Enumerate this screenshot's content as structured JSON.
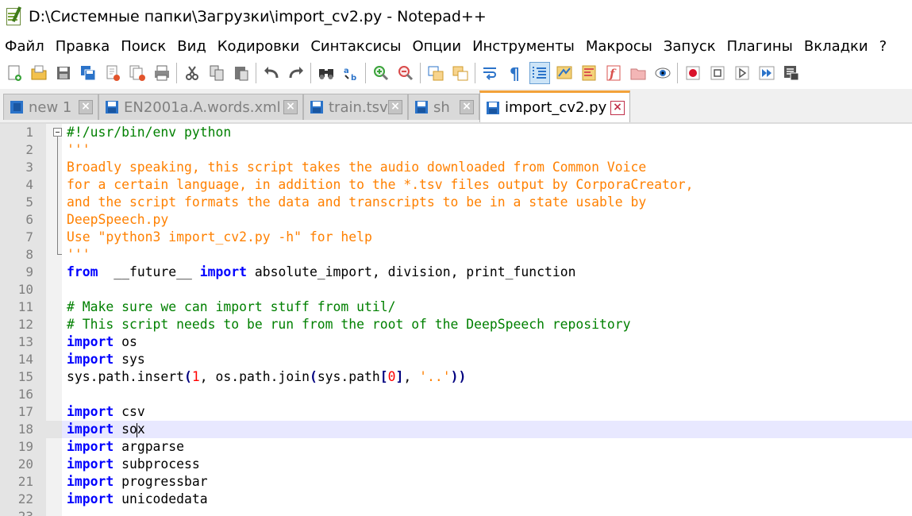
{
  "window": {
    "title": "D:\\Системные папки\\Загрузки\\import_cv2.py - Notepad++"
  },
  "menu": [
    "Файл",
    "Правка",
    "Поиск",
    "Вид",
    "Кодировки",
    "Синтаксисы",
    "Опции",
    "Инструменты",
    "Макросы",
    "Запуск",
    "Плагины",
    "Вкладки",
    "?"
  ],
  "toolbar": [
    {
      "name": "new-file-icon"
    },
    {
      "name": "open-file-icon"
    },
    {
      "name": "save-icon"
    },
    {
      "name": "save-all-icon"
    },
    {
      "name": "close-icon"
    },
    {
      "name": "close-all-icon"
    },
    {
      "name": "print-icon"
    },
    {
      "sep": true
    },
    {
      "name": "cut-icon"
    },
    {
      "name": "copy-icon"
    },
    {
      "name": "paste-icon"
    },
    {
      "sep": true
    },
    {
      "name": "undo-icon"
    },
    {
      "name": "redo-icon"
    },
    {
      "sep": true
    },
    {
      "name": "find-icon"
    },
    {
      "name": "replace-icon"
    },
    {
      "sep": true
    },
    {
      "name": "zoom-in-icon"
    },
    {
      "name": "zoom-out-icon"
    },
    {
      "sep": true
    },
    {
      "name": "sync-vertical-icon"
    },
    {
      "name": "sync-horizontal-icon"
    },
    {
      "sep": true
    },
    {
      "name": "word-wrap-icon"
    },
    {
      "name": "show-all-characters-icon"
    },
    {
      "name": "indent-guide-icon",
      "pressed": true
    },
    {
      "name": "user-language-icon"
    },
    {
      "name": "document-map-icon"
    },
    {
      "name": "function-list-icon"
    },
    {
      "name": "folder-workspace-icon"
    },
    {
      "name": "monitoring-icon"
    },
    {
      "sep": true
    },
    {
      "name": "record-macro-icon"
    },
    {
      "name": "stop-recording-icon"
    },
    {
      "name": "playback-macro-icon"
    },
    {
      "name": "run-macro-multiple-icon"
    },
    {
      "name": "save-macro-icon"
    }
  ],
  "tabs": [
    {
      "label": "new 1",
      "icon": "notebook"
    },
    {
      "label": "EN2001a.A.words.xml",
      "icon": "disk"
    },
    {
      "label": "train.tsv",
      "icon": "disk"
    },
    {
      "label": "sh",
      "icon": "disk"
    },
    {
      "label": "import_cv2.py",
      "icon": "disk",
      "active": true
    }
  ],
  "editor": {
    "current_line": 18,
    "lines": [
      [
        [
          "com",
          "#!/usr/bin/env python"
        ]
      ],
      [
        [
          "str",
          "'''"
        ]
      ],
      [
        [
          "str",
          "Broadly speaking, this script takes the audio downloaded from Common Voice"
        ]
      ],
      [
        [
          "str",
          "for a certain language, in addition to the *.tsv files output by CorporaCreator,"
        ]
      ],
      [
        [
          "str",
          "and the script formats the data and transcripts to be in a state usable by"
        ]
      ],
      [
        [
          "str",
          "DeepSpeech.py"
        ]
      ],
      [
        [
          "str",
          "Use \"python3 import_cv2.py -h\" for help"
        ]
      ],
      [
        [
          "str",
          "'''"
        ]
      ],
      [
        [
          "kw",
          "from"
        ],
        [
          "",
          "  __future__ "
        ],
        [
          "kw",
          "import"
        ],
        [
          "",
          " absolute_import, division, print_function"
        ]
      ],
      [],
      [
        [
          "com",
          "# Make sure we can import stuff from util/"
        ]
      ],
      [
        [
          "com",
          "# This script needs to be run from the root of the DeepSpeech repository"
        ]
      ],
      [
        [
          "kw",
          "import"
        ],
        [
          "",
          " os"
        ]
      ],
      [
        [
          "kw",
          "import"
        ],
        [
          "",
          " sys"
        ]
      ],
      [
        [
          "",
          "sys.path.insert"
        ],
        [
          "op",
          "("
        ],
        [
          "num",
          "1"
        ],
        [
          "",
          ", os.path.join"
        ],
        [
          "op",
          "("
        ],
        [
          "",
          "sys.path"
        ],
        [
          "op",
          "["
        ],
        [
          "num",
          "0"
        ],
        [
          "op",
          "]"
        ],
        [
          "",
          ", "
        ],
        [
          "str",
          "'..'"
        ],
        [
          "op",
          "))"
        ]
      ],
      [],
      [
        [
          "kw",
          "import"
        ],
        [
          "",
          " csv"
        ]
      ],
      [
        [
          "kw",
          "import"
        ],
        [
          "",
          " so"
        ],
        [
          "caret",
          ""
        ],
        [
          "",
          "x"
        ]
      ],
      [
        [
          "kw",
          "import"
        ],
        [
          "",
          " argparse"
        ]
      ],
      [
        [
          "kw",
          "import"
        ],
        [
          "",
          " subprocess"
        ]
      ],
      [
        [
          "kw",
          "import"
        ],
        [
          "",
          " progressbar"
        ]
      ],
      [
        [
          "kw",
          "import"
        ],
        [
          "",
          " unicodedata"
        ]
      ],
      []
    ]
  }
}
